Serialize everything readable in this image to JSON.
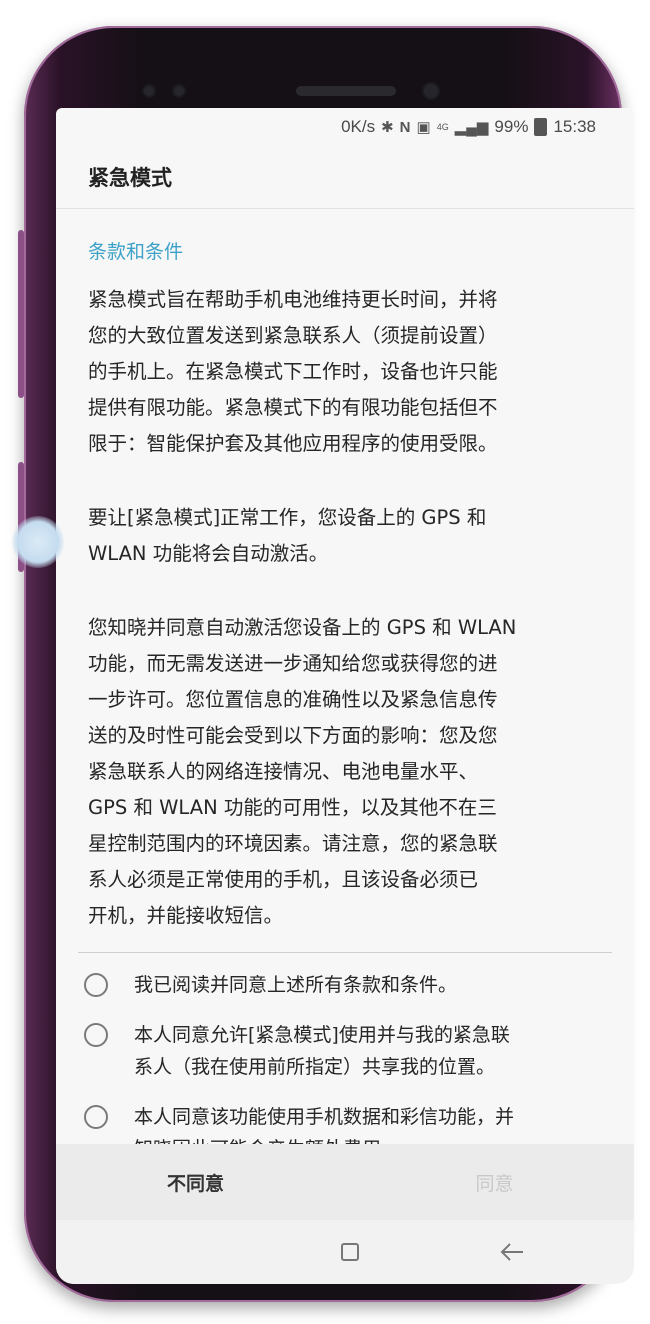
{
  "status_bar": {
    "speed": "0K/s",
    "signal_label": "4G",
    "battery": "99%",
    "time": "15:38",
    "icons": [
      "bluetooth-icon",
      "nfc-icon",
      "vibrate-icon",
      "signal-icon",
      "battery-icon"
    ]
  },
  "app_bar": {
    "title": "紧急模式"
  },
  "content": {
    "section_title": "条款和条件",
    "paragraphs": [
      "紧急模式旨在帮助手机电池维持更长时间，并将\n您的大致位置发送到紧急联系人（须提前设置）\n的手机上。在紧急模式下工作时，设备也许只能\n提供有限功能。紧急模式下的有限功能包括但不\n限于：智能保护套及其他应用程序的使用受限。",
      "要让[紧急模式]正常工作，您设备上的 GPS 和\nWLAN 功能将会自动激活。",
      "您知晓并同意自动激活您设备上的 GPS 和 WLAN\n功能，而无需发送进一步通知给您或获得您的进\n一步许可。您位置信息的准确性以及紧急信息传\n送的及时性可能会受到以下方面的影响：您及您\n紧急联系人的网络连接情况、电池电量水平、\nGPS 和 WLAN 功能的可用性，以及其他不在三\n星控制范围内的环境因素。请注意，您的紧急联\n系人必须是正常使用的手机，且该设备必须已\n开机，并能接收短信。"
    ]
  },
  "checklist": [
    {
      "label": "我已阅读并同意上述所有条款和条件。",
      "checked": false
    },
    {
      "label": "本人同意允许[紧急模式]使用并与我的紧急联\n系人（我在使用前所指定）共享我的位置。",
      "checked": false
    },
    {
      "label": "本人同意该功能使用手机数据和彩信功能，并\n知晓因此可能会产生额外费用。",
      "checked": false
    }
  ],
  "buttons": {
    "disagree": "不同意",
    "agree": "同意"
  },
  "nav_bar": {
    "icons": [
      "recents-icon",
      "back-icon"
    ]
  },
  "colors": {
    "accent": "#3ea2c8",
    "phone_frame": "#6b3163",
    "disabled_text": "#c8c8c8"
  }
}
